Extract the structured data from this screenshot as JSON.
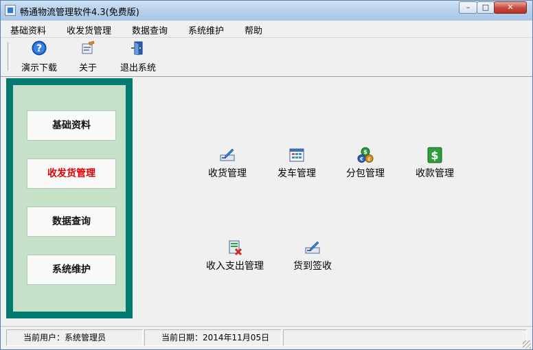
{
  "window": {
    "title": "畅通物流管理软件4.3(免费版)",
    "minimize": "–",
    "maximize": "□",
    "close": "✕"
  },
  "menu": [
    "基础资料",
    "收发货管理",
    "数据查询",
    "系统维护",
    "帮助"
  ],
  "toolbar": [
    {
      "label": "演示下载",
      "icon": "help-icon"
    },
    {
      "label": "关于",
      "icon": "about-icon"
    },
    {
      "label": "退出系统",
      "icon": "exit-door-icon"
    }
  ],
  "sidebar": [
    {
      "label": "基础资料",
      "active": false
    },
    {
      "label": "收发货管理",
      "active": true
    },
    {
      "label": "数据查询",
      "active": false
    },
    {
      "label": "系统维护",
      "active": false
    }
  ],
  "functions": [
    {
      "label": "收货管理",
      "icon": "receive-goods-icon"
    },
    {
      "label": "发车管理",
      "icon": "dispatch-icon"
    },
    {
      "label": "分包管理",
      "icon": "subpackage-coins-icon"
    },
    {
      "label": "收款管理",
      "icon": "dollar-icon"
    },
    {
      "label": "收入支出管理",
      "icon": "income-expense-icon"
    },
    {
      "label": "货到签收",
      "icon": "sign-receipt-icon"
    }
  ],
  "status": {
    "user": "当前用户：系统管理员",
    "date": "当前日期：2014年11月05日"
  },
  "colors": {
    "sidebar_frame": "#007b72",
    "sidebar_bg": "#c5e2c8",
    "active_text": "#e00000"
  }
}
